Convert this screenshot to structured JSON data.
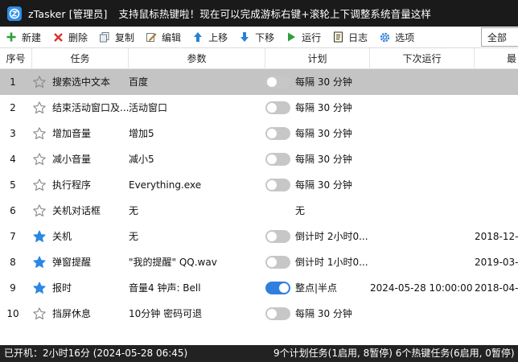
{
  "window": {
    "title": "zTasker [管理员]",
    "notice": "支持鼠标热键啦！现在可以完成游标右键+滚轮上下调整系统音量这样"
  },
  "toolbar": {
    "new": "新建",
    "delete": "删除",
    "copy": "复制",
    "edit": "编辑",
    "move_up": "上移",
    "move_down": "下移",
    "run": "运行",
    "log": "日志",
    "options": "选项",
    "filter": "全部",
    "colors": {
      "new": "#2e9e3a",
      "delete": "#d9342b",
      "move": "#2b7fd8",
      "run": "#2e9e3a"
    }
  },
  "table": {
    "headers": [
      "序号",
      "任务",
      "参数",
      "计划",
      "下次运行",
      "最"
    ],
    "rows": [
      {
        "index": "1",
        "starred": false,
        "task": "搜索选中文本",
        "param": "百度",
        "toggle": "off",
        "plan": "每隔 30 分钟",
        "next": "",
        "last": "",
        "selected": true
      },
      {
        "index": "2",
        "starred": false,
        "task": "结束活动窗口及...",
        "param": "活动窗口",
        "toggle": "off",
        "plan": "每隔 30 分钟",
        "next": "",
        "last": "",
        "selected": false
      },
      {
        "index": "3",
        "starred": false,
        "task": "增加音量",
        "param": "增加5",
        "toggle": "off",
        "plan": "每隔 30 分钟",
        "next": "",
        "last": "",
        "selected": false
      },
      {
        "index": "4",
        "starred": false,
        "task": "减小音量",
        "param": "减小5",
        "toggle": "off",
        "plan": "每隔 30 分钟",
        "next": "",
        "last": "",
        "selected": false
      },
      {
        "index": "5",
        "starred": false,
        "task": "执行程序",
        "param": "Everything.exe",
        "toggle": "off",
        "plan": "每隔 30 分钟",
        "next": "",
        "last": "",
        "selected": false
      },
      {
        "index": "6",
        "starred": false,
        "task": "关机对话框",
        "param": "无",
        "toggle": "none",
        "plan": "无",
        "next": "",
        "last": "",
        "selected": false
      },
      {
        "index": "7",
        "starred": true,
        "task": "关机",
        "param": "无",
        "toggle": "off",
        "plan": "倒计时 2小时0...",
        "next": "",
        "last": "2018-12-",
        "selected": false
      },
      {
        "index": "8",
        "starred": true,
        "task": "弹窗提醒",
        "param": "\"我的提醒\" QQ.wav",
        "toggle": "off",
        "plan": "倒计时 1小时0...",
        "next": "",
        "last": "2019-03-",
        "selected": false
      },
      {
        "index": "9",
        "starred": true,
        "task": "报时",
        "param": "音量4 钟声: Bell",
        "toggle": "on",
        "plan": "整点|半点",
        "next": "2024-05-28 10:00:00",
        "last": "2018-04-",
        "selected": false
      },
      {
        "index": "10",
        "starred": false,
        "task": "挡屏休息",
        "param": "10分钟 密码可退",
        "toggle": "off",
        "plan": "每隔 30 分钟",
        "next": "",
        "last": "",
        "selected": false
      }
    ]
  },
  "statusbar": {
    "uptime": "已开机：2小时16分 (2024-05-28 06:45)",
    "summary": "9个计划任务(1启用, 8暂停)  6个热键任务(6启用, 0暂停)"
  },
  "colors": {
    "star_active": "#2b87e3",
    "toggle_on": "#2f7fe0",
    "toggle_off": "#c7c7c7",
    "selected_row": "#c4c4c4"
  }
}
